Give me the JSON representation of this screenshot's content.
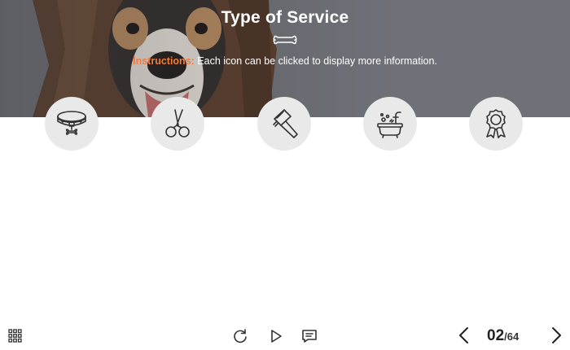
{
  "header": {
    "title": "Type of Service",
    "instructions_lead": "Instructions:",
    "instructions_text": " Each icon can be clicked to display more information."
  },
  "services": [
    {
      "icon": "dog-collar-icon"
    },
    {
      "icon": "scissors-icon"
    },
    {
      "icon": "comb-icon"
    },
    {
      "icon": "bathtub-icon"
    },
    {
      "icon": "award-ribbon-icon"
    }
  ],
  "player": {
    "current_page": "02",
    "total_pages": "/64"
  },
  "colors": {
    "accent": "#f07a3c",
    "icon_circle": "#e9e9e9",
    "icon_stroke": "#333333"
  }
}
